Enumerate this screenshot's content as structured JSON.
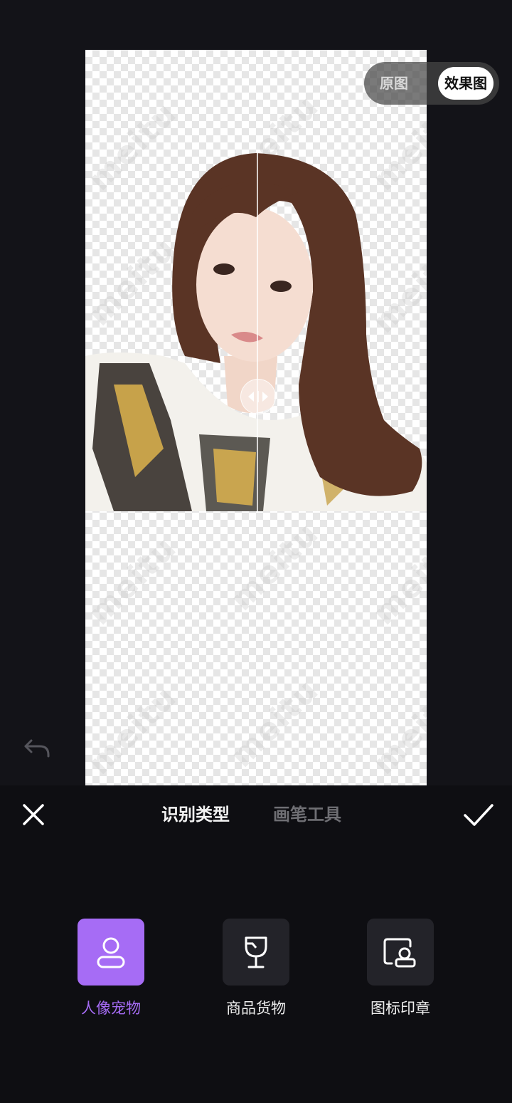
{
  "compare_toggle": {
    "original_label": "原图",
    "effect_label": "效果图",
    "selected": "效果图"
  },
  "canvas": {
    "watermark_text": "meitu"
  },
  "bottom_panel": {
    "tabs": [
      {
        "label": "识别类型",
        "active": true
      },
      {
        "label": "画笔工具",
        "active": false
      }
    ],
    "options": [
      {
        "label": "人像宠物",
        "icon": "person-icon",
        "active": true
      },
      {
        "label": "商品货物",
        "icon": "goblet-icon",
        "active": false
      },
      {
        "label": "图标印章",
        "icon": "stamp-icon",
        "active": false
      }
    ]
  },
  "colors": {
    "accent": "#a66cf5",
    "background": "#131318",
    "panel": "#0e0e12"
  }
}
